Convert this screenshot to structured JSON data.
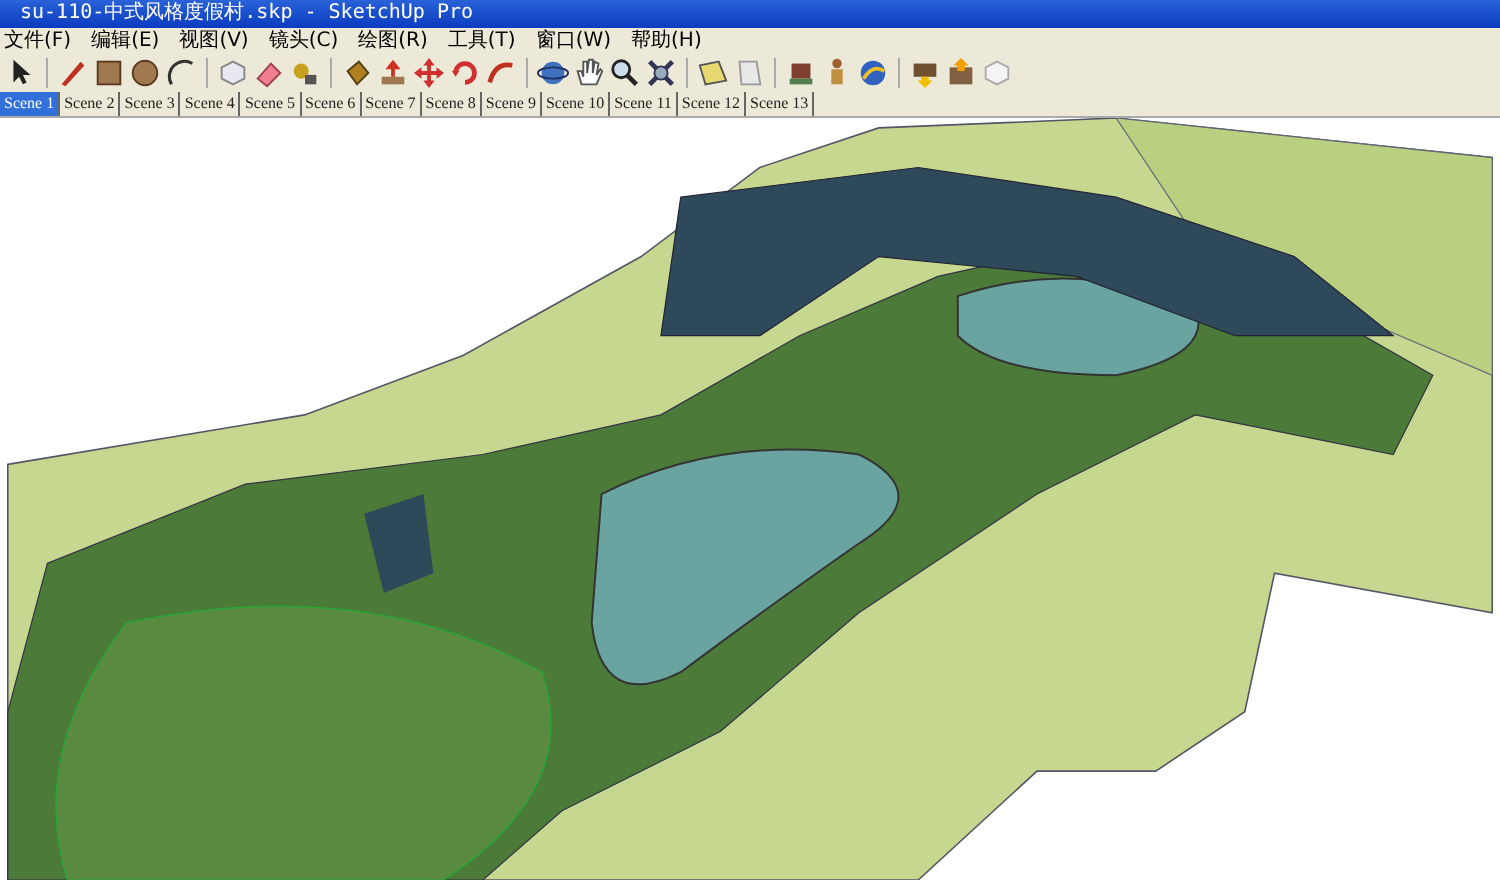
{
  "window": {
    "title": "su-110-中式风格度假村.skp - SketchUp Pro"
  },
  "menu": [
    "文件(F)",
    "编辑(E)",
    "视图(V)",
    "镜头(C)",
    "绘图(R)",
    "工具(T)",
    "窗口(W)",
    "帮助(H)"
  ],
  "scenes": [
    {
      "label": "Scene 1",
      "selected": true
    },
    {
      "label": "Scene 2",
      "selected": false
    },
    {
      "label": "Scene 3",
      "selected": false
    },
    {
      "label": "Scene 4",
      "selected": false
    },
    {
      "label": "Scene 5",
      "selected": false
    },
    {
      "label": "Scene 6",
      "selected": false
    },
    {
      "label": "Scene 7",
      "selected": false
    },
    {
      "label": "Scene 8",
      "selected": false
    },
    {
      "label": "Scene 9",
      "selected": false
    },
    {
      "label": "Scene 10",
      "selected": false
    },
    {
      "label": "Scene 11",
      "selected": false
    },
    {
      "label": "Scene 12",
      "selected": false
    },
    {
      "label": "Scene 13",
      "selected": false
    }
  ]
}
